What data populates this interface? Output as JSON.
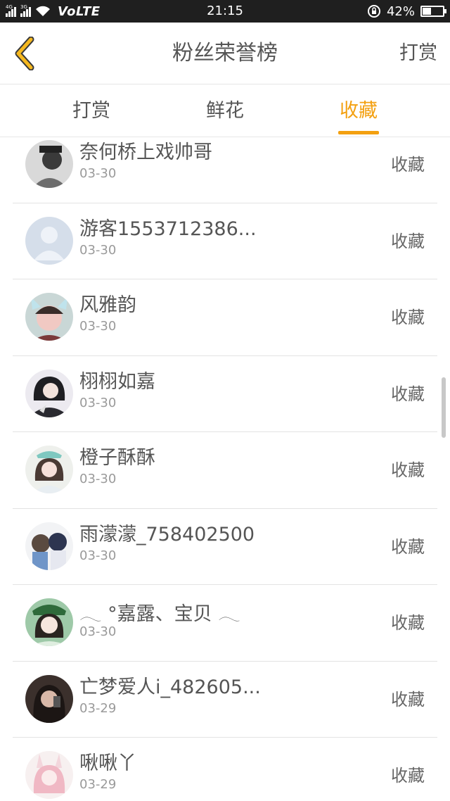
{
  "status_bar": {
    "signal1_tag": "4G",
    "signal2_tag": "3G",
    "network": "VoLTE",
    "time": "21:15",
    "battery": "42%",
    "battery_level": 0.42,
    "icons": [
      "signal-icon",
      "wifi-icon",
      "rotation-lock-icon",
      "battery-icon"
    ]
  },
  "header": {
    "back_icon": "chevron-left-icon",
    "title": "粉丝荣誉榜",
    "action": "打赏"
  },
  "tabs": [
    {
      "label": "打赏",
      "active": false
    },
    {
      "label": "鲜花",
      "active": false
    },
    {
      "label": "收藏",
      "active": true
    }
  ],
  "colors": {
    "accent": "#f3a010",
    "status_bar_bg": "#1f1f1f",
    "text": "#555555",
    "subtext": "#9a9a9a",
    "divider": "#e3e3e3"
  },
  "fans": [
    {
      "name": "奈何桥上戏帅哥",
      "date": "03-30",
      "action": "收藏",
      "avatar": "photo-avatar-icon"
    },
    {
      "name": "游客1553712386...",
      "date": "03-30",
      "action": "收藏",
      "avatar": "default-user-avatar-icon"
    },
    {
      "name": "风雅韵",
      "date": "03-30",
      "action": "收藏",
      "avatar": "photo-avatar-icon"
    },
    {
      "name": "栩栩如嘉",
      "date": "03-30",
      "action": "收藏",
      "avatar": "photo-avatar-icon"
    },
    {
      "name": "橙子酥酥",
      "date": "03-30",
      "action": "收藏",
      "avatar": "photo-avatar-icon"
    },
    {
      "name": "雨濛濛_758402500",
      "date": "03-30",
      "action": "收藏",
      "avatar": "photo-avatar-icon"
    },
    {
      "name": "𓂃 °嘉露、宝贝 𓂃",
      "date": "03-30",
      "action": "收藏",
      "avatar": "photo-avatar-icon"
    },
    {
      "name": "亡梦爱人i_482605...",
      "date": "03-29",
      "action": "收藏",
      "avatar": "photo-avatar-icon"
    },
    {
      "name": "啾啾丫",
      "date": "03-29",
      "action": "收藏",
      "avatar": "photo-avatar-icon"
    }
  ]
}
